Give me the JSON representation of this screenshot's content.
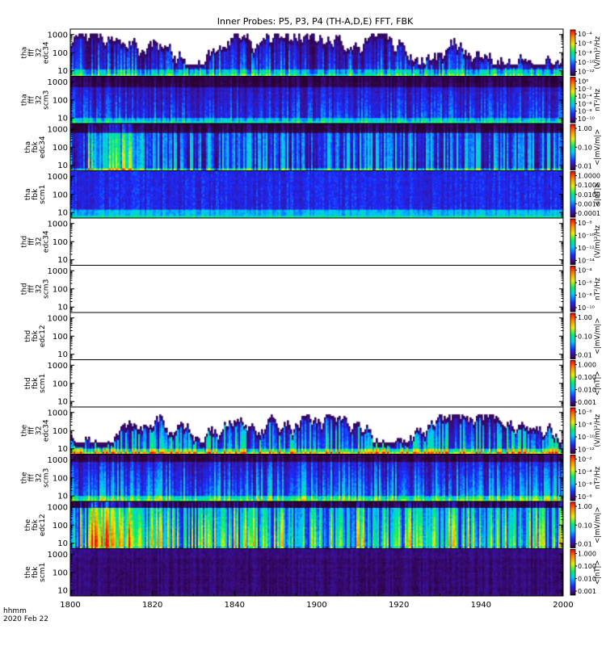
{
  "chart_data": {
    "type": "heatmap",
    "title": "Inner Probes: P5, P3, P4 (TH-A,D,E) FFT, FBK",
    "x": {
      "ticks": [
        "1800",
        "1820",
        "1840",
        "1900",
        "1920",
        "1940",
        "2000"
      ],
      "label_time": "hhmm",
      "label_date": "2020 Feb 22"
    },
    "y_ticks": [
      "1000",
      "100",
      "10"
    ],
    "panels": [
      {
        "label": [
          "tha",
          "fff",
          "32",
          "edc34"
        ],
        "colorbar": {
          "label": "(V/m)²/Hz",
          "ticks": [
            "10⁻⁴",
            "10⁻⁶",
            "10⁻⁸",
            "10⁻¹⁰",
            "10⁻¹²"
          ]
        },
        "has_data": true,
        "style": "fff_e"
      },
      {
        "label": [
          "tha",
          "fff",
          "32",
          "scm3"
        ],
        "colorbar": {
          "label": "nT²/Hz",
          "ticks": [
            "10⁰",
            "10⁻²",
            "10⁻⁴",
            "10⁻⁶",
            "10⁻⁸",
            "10⁻¹⁰"
          ]
        },
        "has_data": true,
        "style": "fff_b"
      },
      {
        "label": [
          "tha",
          "fbk",
          "edc34"
        ],
        "colorbar": {
          "label": "<|mV/m|>",
          "ticks": [
            "1.00",
            "0.10",
            "0.01"
          ]
        },
        "has_data": true,
        "style": "fbk_e"
      },
      {
        "label": [
          "tha",
          "fbk",
          "scm1"
        ],
        "colorbar": {
          "label": "<|nT|>",
          "ticks": [
            "1.0000",
            "0.1000",
            "0.0100",
            "0.0010",
            "0.0001"
          ]
        },
        "has_data": true,
        "style": "fbk_b"
      },
      {
        "label": [
          "thd",
          "fff",
          "32",
          "edc34"
        ],
        "colorbar": {
          "label": "(V/m)²/Hz",
          "ticks": [
            "10⁻⁸",
            "10⁻¹⁰",
            "10⁻¹²",
            "10⁻¹⁴"
          ]
        },
        "has_data": false,
        "style": "empty"
      },
      {
        "label": [
          "thd",
          "fff",
          "32",
          "scm3"
        ],
        "colorbar": {
          "label": "nT²/Hz",
          "ticks": [
            "10⁻⁴",
            "10⁻⁶",
            "10⁻⁸",
            "10⁻¹⁰"
          ]
        },
        "has_data": false,
        "style": "empty"
      },
      {
        "label": [
          "thd",
          "fbk",
          "edc12"
        ],
        "colorbar": {
          "label": "<|mV/m|>",
          "ticks": [
            "1.00",
            "0.10",
            "0.01"
          ]
        },
        "has_data": false,
        "style": "empty"
      },
      {
        "label": [
          "thd",
          "fbk",
          "scm1"
        ],
        "colorbar": {
          "label": "<|nT|>",
          "ticks": [
            "1.000",
            "0.100",
            "0.010",
            "0.001"
          ]
        },
        "has_data": false,
        "style": "empty"
      },
      {
        "label": [
          "the",
          "fff",
          "32",
          "edc34"
        ],
        "colorbar": {
          "label": "(V/m)²/Hz",
          "ticks": [
            "10⁻⁶",
            "10⁻⁸",
            "10⁻¹⁰",
            "10⁻¹²"
          ]
        },
        "has_data": true,
        "style": "fff_e2"
      },
      {
        "label": [
          "the",
          "fff",
          "32",
          "scm3"
        ],
        "colorbar": {
          "label": "nT²/Hz",
          "ticks": [
            "10⁻²",
            "10⁻⁴",
            "10⁻⁶",
            "10⁻⁸"
          ]
        },
        "has_data": true,
        "style": "fff_b2"
      },
      {
        "label": [
          "the",
          "fbk",
          "edc12"
        ],
        "colorbar": {
          "label": "<|mV/m|>",
          "ticks": [
            "1.00",
            "0.10",
            "0.01"
          ]
        },
        "has_data": true,
        "style": "fbk_e2"
      },
      {
        "label": [
          "the",
          "fbk",
          "scm1"
        ],
        "colorbar": {
          "label": "<|nT|>",
          "ticks": [
            "1.000",
            "0.100",
            "0.010",
            "0.001"
          ]
        },
        "has_data": true,
        "style": "fbk_b2"
      }
    ]
  }
}
